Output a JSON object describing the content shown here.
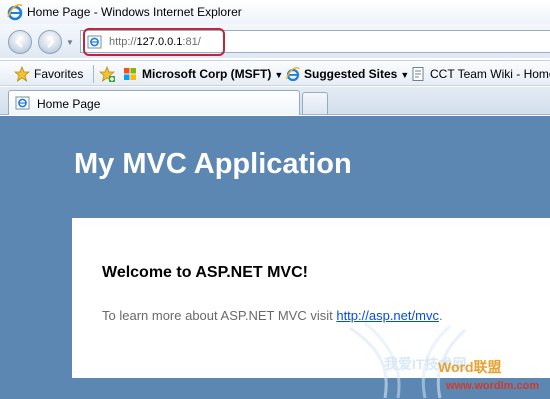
{
  "window": {
    "title": "Home Page - Windows Internet Explorer"
  },
  "address_bar": {
    "url_prefix": "http://",
    "url_host": "127.0.0.1",
    "url_suffix": ":81/"
  },
  "favorites_bar": {
    "favorites_label": "Favorites",
    "items": [
      {
        "label": "Microsoft Corp (MSFT)",
        "icon": "windows-flag-icon",
        "has_dropdown": true
      },
      {
        "label": "Suggested Sites",
        "icon": "ie-logo-icon",
        "has_dropdown": true
      },
      {
        "label": "CCT Team Wiki - Home",
        "icon": "page-icon",
        "has_dropdown": false
      }
    ]
  },
  "tabs": [
    {
      "label": "Home Page",
      "active": true
    }
  ],
  "page": {
    "app_title": "My MVC Application",
    "welcome_heading": "Welcome to ASP.NET MVC!",
    "learn_more_text": "To learn more about ASP.NET MVC visit ",
    "learn_more_link": "http://asp.net/mvc",
    "learn_more_end": "."
  },
  "watermark": {
    "brand": "Word联盟",
    "url": "www.wordlm.com",
    "chinese": "我爱IT技术网"
  },
  "colors": {
    "page_background": "#5c87b2",
    "panel_background": "#ffffff",
    "link": "#034af3",
    "highlight_box": "#c0253f"
  }
}
